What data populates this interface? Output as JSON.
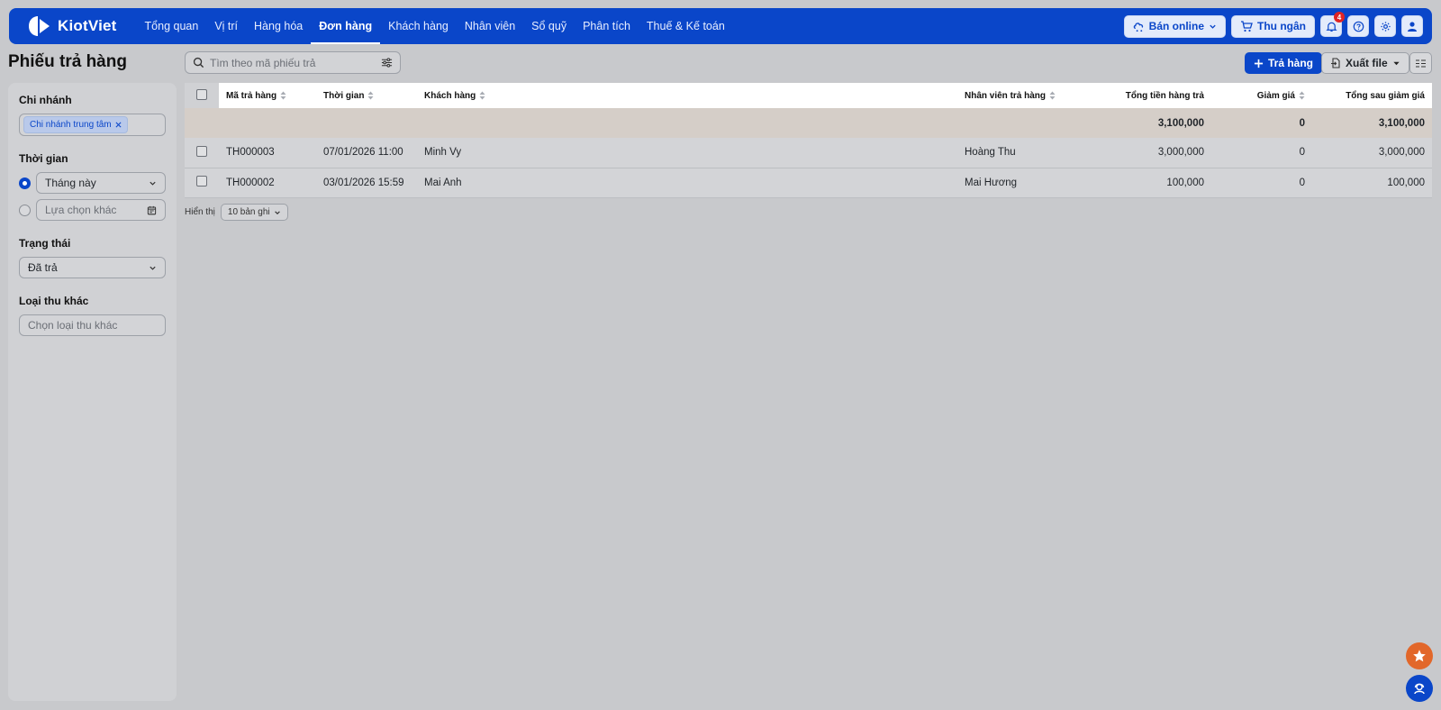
{
  "app": {
    "name": "KiotViet"
  },
  "nav": {
    "items": [
      {
        "label": "Tổng quan",
        "active": false
      },
      {
        "label": "Vị trí",
        "active": false
      },
      {
        "label": "Hàng hóa",
        "active": false
      },
      {
        "label": "Đơn hàng",
        "active": true
      },
      {
        "label": "Khách hàng",
        "active": false
      },
      {
        "label": "Nhân viên",
        "active": false
      },
      {
        "label": "Sổ quỹ",
        "active": false
      },
      {
        "label": "Phân tích",
        "active": false
      },
      {
        "label": "Thuế & Kế toán",
        "active": false
      }
    ],
    "sell_online": "Bán online",
    "cashier": "Thu ngân",
    "notification_count": "4"
  },
  "page": {
    "title": "Phiếu trả hàng",
    "search_placeholder": "Tìm theo mã phiếu trả",
    "return_button": "Trả hàng",
    "export_button": "Xuất file"
  },
  "sidebar": {
    "branch": {
      "label": "Chi nhánh",
      "chip": "Chi nhánh trung tâm"
    },
    "time": {
      "label": "Thời gian",
      "preset": "Tháng này",
      "custom_placeholder": "Lựa chọn khác"
    },
    "status": {
      "label": "Trạng thái",
      "value": "Đã trả"
    },
    "other_income": {
      "label": "Loại thu khác",
      "placeholder": "Chọn loại thu khác"
    }
  },
  "table": {
    "headers": {
      "code": "Mã trả hàng",
      "time": "Thời gian",
      "customer": "Khách hàng",
      "staff": "Nhân viên trả hàng",
      "total": "Tổng tiền hàng trả",
      "discount": "Giảm giá",
      "after_discount": "Tổng sau giảm giá"
    },
    "summary": {
      "total": "3,100,000",
      "discount": "0",
      "after_discount": "3,100,000"
    },
    "rows": [
      {
        "code": "TH000003",
        "time": "07/01/2026 11:00",
        "customer": "Minh Vy",
        "staff": "Hoàng Thu",
        "total": "3,000,000",
        "discount": "0",
        "after_discount": "3,000,000"
      },
      {
        "code": "TH000002",
        "time": "03/01/2026 15:59",
        "customer": "Mai Anh",
        "staff": "Mai Hương",
        "total": "100,000",
        "discount": "0",
        "after_discount": "100,000"
      }
    ]
  },
  "pager": {
    "label": "Hiển thị",
    "page_size": "10 bản ghi"
  },
  "colors": {
    "brand": "#0a46c9",
    "accent_orange": "#e2672a",
    "badge_red": "#e02424"
  }
}
